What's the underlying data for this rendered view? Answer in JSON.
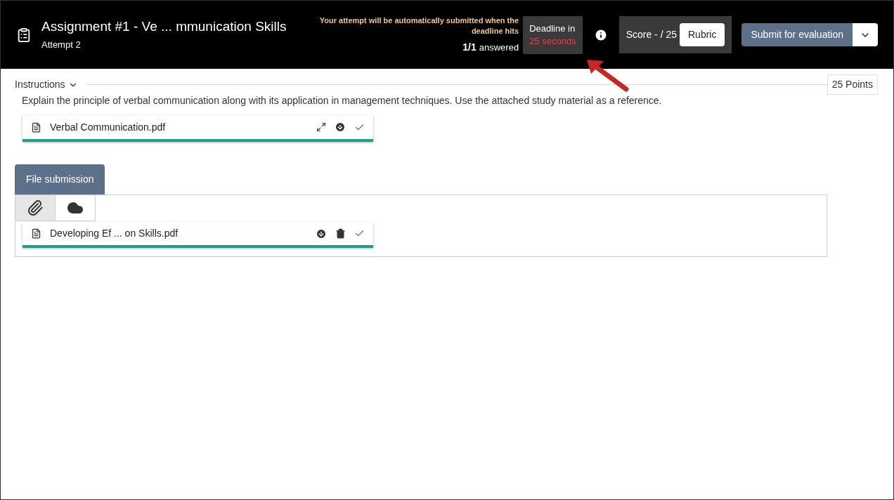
{
  "header": {
    "title": "Assignment #1 - Ve ... mmunication Skills",
    "subtitle": "Attempt 2",
    "notice": "Your attempt will be automatically submitted when the deadline hits",
    "answered_count": "1/1",
    "answered_label": "answered",
    "deadline_label": "Deadline in",
    "deadline_value": "25 seconds",
    "score": "Score - / 25",
    "rubric_button": "Rubric",
    "submit_button": "Submit for evaluation"
  },
  "instructions": {
    "label": "Instructions",
    "expanded": true,
    "points": "25 Points",
    "text": "Explain the principle of verbal communication along with its application in management techniques. Use the attached study material as a reference.",
    "attachment": {
      "name": "Verbal Communication.pdf",
      "level": 1
    }
  },
  "submission": {
    "tab": "File submission",
    "sources": [
      {
        "kind": "attach",
        "selected": true
      },
      {
        "kind": "cloud",
        "selected": false
      }
    ],
    "files": [
      {
        "name": "Developing Ef ... on Skills.pdf",
        "level": 1
      }
    ]
  }
}
